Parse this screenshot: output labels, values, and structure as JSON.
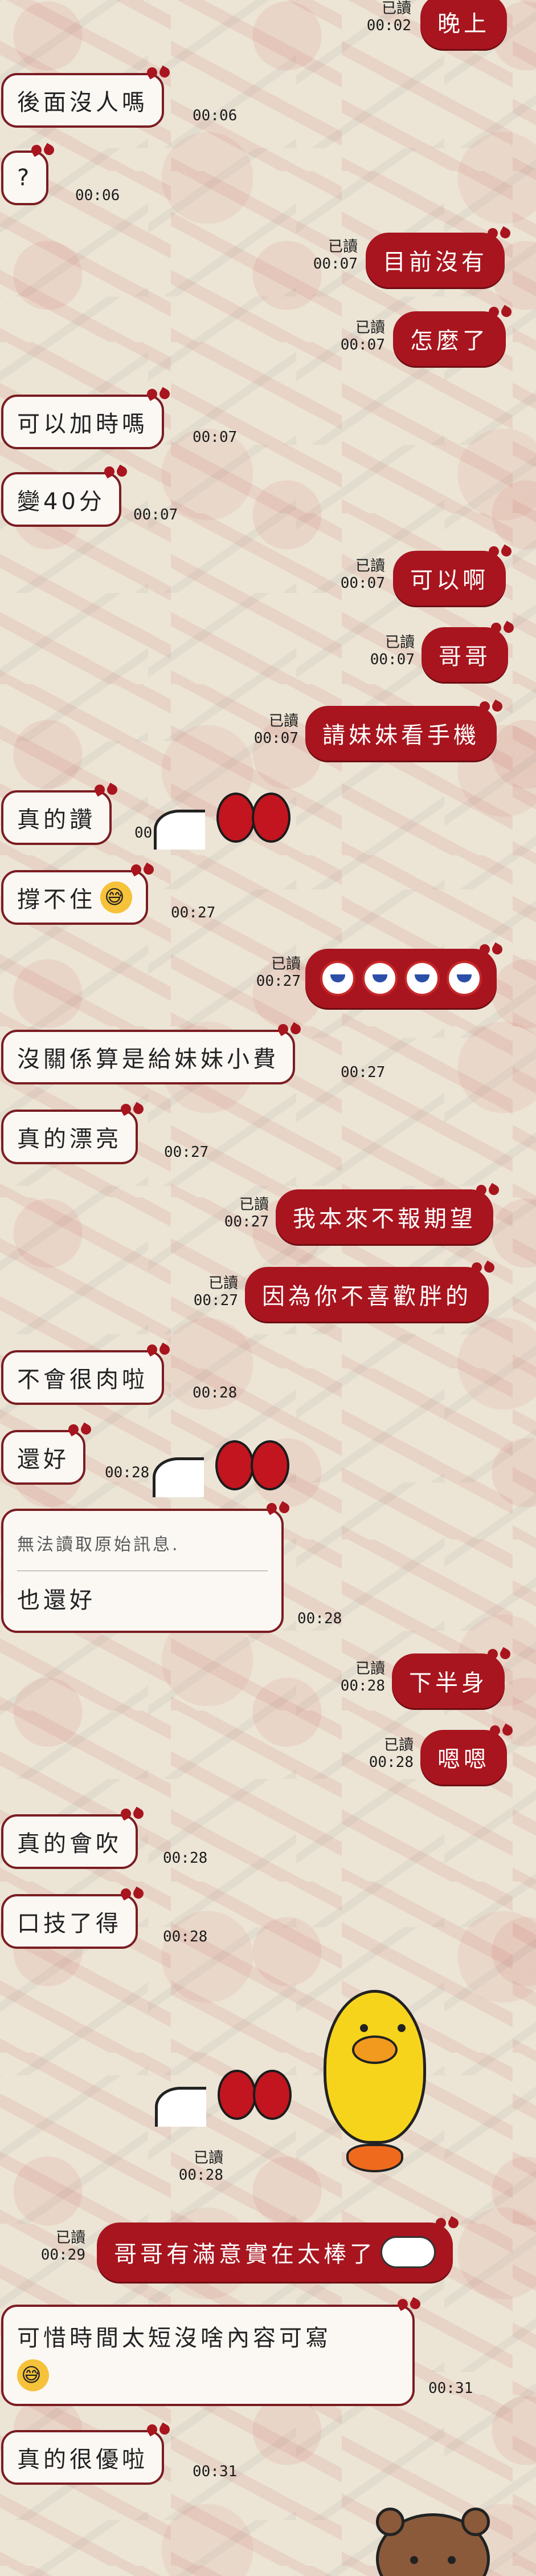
{
  "chat": {
    "read_label": "已讀",
    "messages": [
      {
        "id": "m1",
        "side": "out",
        "text": "晚上",
        "time": "00:02",
        "read": true
      },
      {
        "id": "m2",
        "side": "in",
        "text": "後面沒人嗎",
        "time": "00:06"
      },
      {
        "id": "m3",
        "side": "in",
        "text": "?",
        "time": "00:06"
      },
      {
        "id": "m4",
        "side": "out",
        "text": "目前沒有",
        "time": "00:07",
        "read": true
      },
      {
        "id": "m5",
        "side": "out",
        "text": "怎麼了",
        "time": "00:07",
        "read": true
      },
      {
        "id": "m6",
        "side": "in",
        "text": "可以加時嗎",
        "time": "00:07"
      },
      {
        "id": "m7",
        "side": "in",
        "text": "變40分",
        "time": "00:07"
      },
      {
        "id": "m8",
        "side": "out",
        "text": "可以啊",
        "time": "00:07",
        "read": true
      },
      {
        "id": "m9",
        "side": "out",
        "text": "哥哥",
        "time": "00:07",
        "read": true
      },
      {
        "id": "m10",
        "side": "out",
        "text": "請妹妹看手機",
        "time": "00:07",
        "read": true
      },
      {
        "id": "m11",
        "side": "in",
        "text": "真的讚",
        "time": "00:27"
      },
      {
        "id": "m12",
        "side": "in",
        "text": "撐不住",
        "emoji": "😅",
        "time": "00:27"
      },
      {
        "id": "m13",
        "side": "out",
        "sticker": "four-kitty-faces",
        "time": "00:27",
        "read": true
      },
      {
        "id": "m14",
        "side": "in",
        "text": "沒關係算是給妹妹小費",
        "time": "00:27"
      },
      {
        "id": "m15",
        "side": "in",
        "text": "真的漂亮",
        "time": "00:27"
      },
      {
        "id": "m16",
        "side": "out",
        "text": "我本來不報期望",
        "time": "00:27",
        "read": true
      },
      {
        "id": "m17",
        "side": "out",
        "text": "因為你不喜歡胖的",
        "time": "00:27",
        "read": true
      },
      {
        "id": "m18",
        "side": "in",
        "text": "不會很肉啦",
        "time": "00:28"
      },
      {
        "id": "m19",
        "side": "in",
        "text": "還好",
        "time": "00:28"
      },
      {
        "id": "m20",
        "side": "in",
        "quoted": "無法讀取原始訊息.",
        "text": "也還好",
        "time": "00:28"
      },
      {
        "id": "m21",
        "side": "out",
        "text": "下半身",
        "time": "00:28",
        "read": true
      },
      {
        "id": "m22",
        "side": "out",
        "text": "嗯嗯",
        "time": "00:28",
        "read": true
      },
      {
        "id": "m23",
        "side": "in",
        "text": "真的會吹",
        "time": "00:28"
      },
      {
        "id": "m24",
        "side": "in",
        "text": "口技了得",
        "time": "00:28"
      },
      {
        "id": "m25",
        "side": "out",
        "sticker": "sally-chick",
        "time": "00:28",
        "read": true
      },
      {
        "id": "m26",
        "side": "out",
        "text": "哥哥有滿意實在太棒了",
        "emoji": "😆😆",
        "time": "00:29",
        "read": true
      },
      {
        "id": "m27",
        "side": "in",
        "text": "可惜時間太短沒啥內容可寫",
        "emoji": "😅",
        "time": "00:31"
      },
      {
        "id": "m28",
        "side": "in",
        "text": "真的很優啦",
        "time": "00:31"
      },
      {
        "id": "m29",
        "side": "in",
        "sticker": "brown-bear",
        "time": ""
      }
    ]
  },
  "colors": {
    "out_bubble": "#a8151e",
    "in_border": "#7a1d22",
    "in_bg": "#fbf8f4"
  }
}
